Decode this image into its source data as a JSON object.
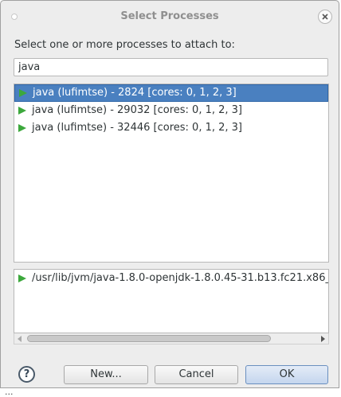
{
  "dialog": {
    "title": "Select Processes",
    "prompt": "Select one or more processes to attach to:",
    "filter_value": "java",
    "processes": [
      {
        "label": "java (lufimtse) - 2824 [cores: 0, 1, 2, 3]",
        "selected": true
      },
      {
        "label": "java (lufimtse) - 29032 [cores: 0, 1, 2, 3]",
        "selected": false
      },
      {
        "label": "java (lufimtse) - 32446 [cores: 0, 1, 2, 3]",
        "selected": false
      }
    ],
    "path": "/usr/lib/jvm/java-1.8.0-openjdk-1.8.0.45-31.b13.fc21.x86_",
    "buttons": {
      "help": "?",
      "new": "New...",
      "cancel": "Cancel",
      "ok": "OK"
    }
  },
  "background_text": "...",
  "icons": {
    "process": "play-icon",
    "close": "close-icon",
    "help": "help-icon"
  },
  "colors": {
    "selection": "#4a80c0",
    "process_icon": "#3ca83c"
  }
}
